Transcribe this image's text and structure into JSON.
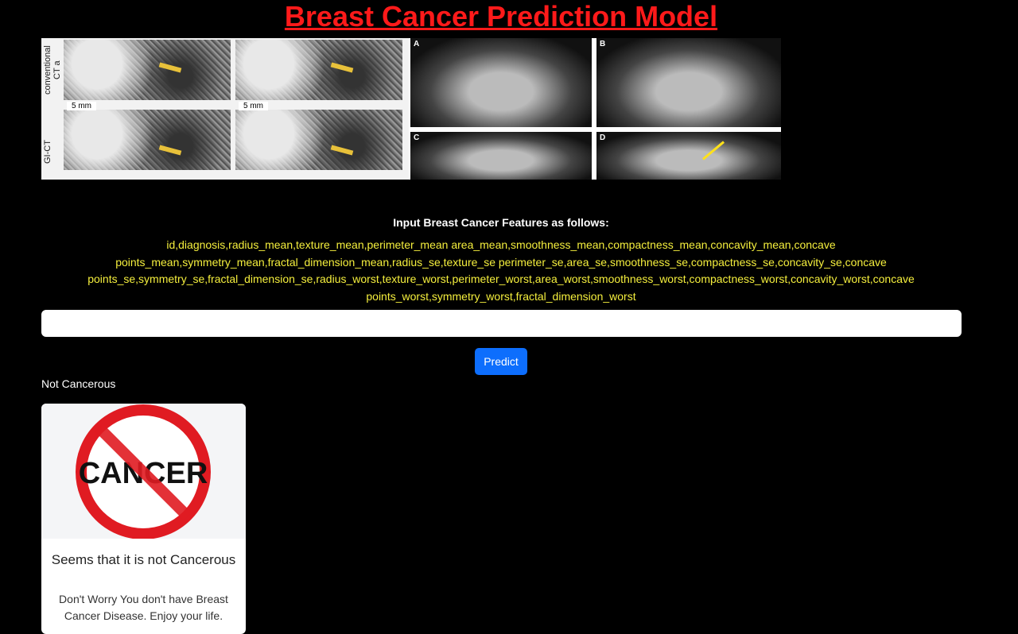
{
  "header": {
    "title": "Breast Cancer Prediction Model"
  },
  "banner": {
    "left_labels": {
      "top": "conventional CT a",
      "bottom": "GI-CT"
    },
    "scale_label": "5 mm",
    "panel_letters": [
      "A",
      "B",
      "C",
      "D"
    ]
  },
  "form": {
    "heading": "Input Breast Cancer Features as follows:",
    "features_text": "id,diagnosis,radius_mean,texture_mean,perimeter_mean area_mean,smoothness_mean,compactness_mean,concavity_mean,concave points_mean,symmetry_mean,fractal_dimension_mean,radius_se,texture_se perimeter_se,area_se,smoothness_se,compactness_se,concavity_se,concave points_se,symmetry_se,fractal_dimension_se,radius_worst,texture_worst,perimeter_worst,area_worst,smoothness_worst,compactness_worst,concavity_worst,concave points_worst,symmetry_worst,fractal_dimension_worst",
    "input_value": "",
    "predict_label": "Predict"
  },
  "result": {
    "text": "Not Cancerous",
    "card": {
      "image_text": "CANCER",
      "title": "Seems that it is not Cancerous",
      "body": "Don't Worry You don't have Breast Cancer Disease. Enjoy your life."
    }
  },
  "colors": {
    "title": "#ff1a1a",
    "features": "#f5ef3d",
    "button": "#0d6efd",
    "background": "#000000"
  }
}
